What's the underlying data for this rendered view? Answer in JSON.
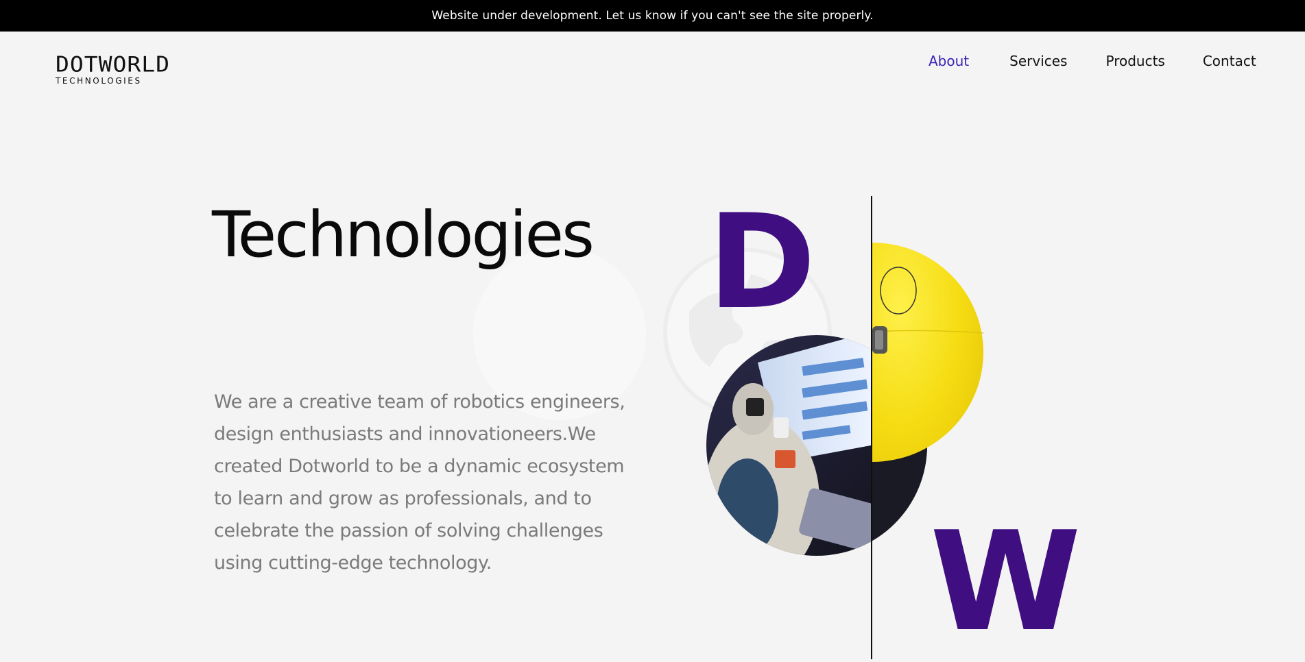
{
  "banner": {
    "text": "Website under development. Let us know if you can't see the site properly."
  },
  "logo": {
    "main": "DOTWORLD",
    "sub": "TECHNOLOGIES"
  },
  "nav": {
    "items": [
      {
        "label": "About",
        "active": true
      },
      {
        "label": "Services",
        "active": false
      },
      {
        "label": "Products",
        "active": false
      },
      {
        "label": "Contact",
        "active": false
      }
    ]
  },
  "hero": {
    "title": "Technologies",
    "description": "We are a creative team of robotics engineers, design enthusiasts and innovationeers.We created Dotworld to be a dynamic ecosystem to learn and grow as professionals, and to celebrate the passion of solving challenges using cutting-edge technology.",
    "letter_left": "D",
    "letter_right": "W"
  },
  "colors": {
    "accent": "#3b23b5",
    "brand_purple": "#3f0e80",
    "yellow": "#f5dc12",
    "background": "#f4f4f4",
    "banner_bg": "#000000",
    "body_text": "#7a7a7a"
  },
  "icons": {
    "globe": "globe-icon"
  }
}
